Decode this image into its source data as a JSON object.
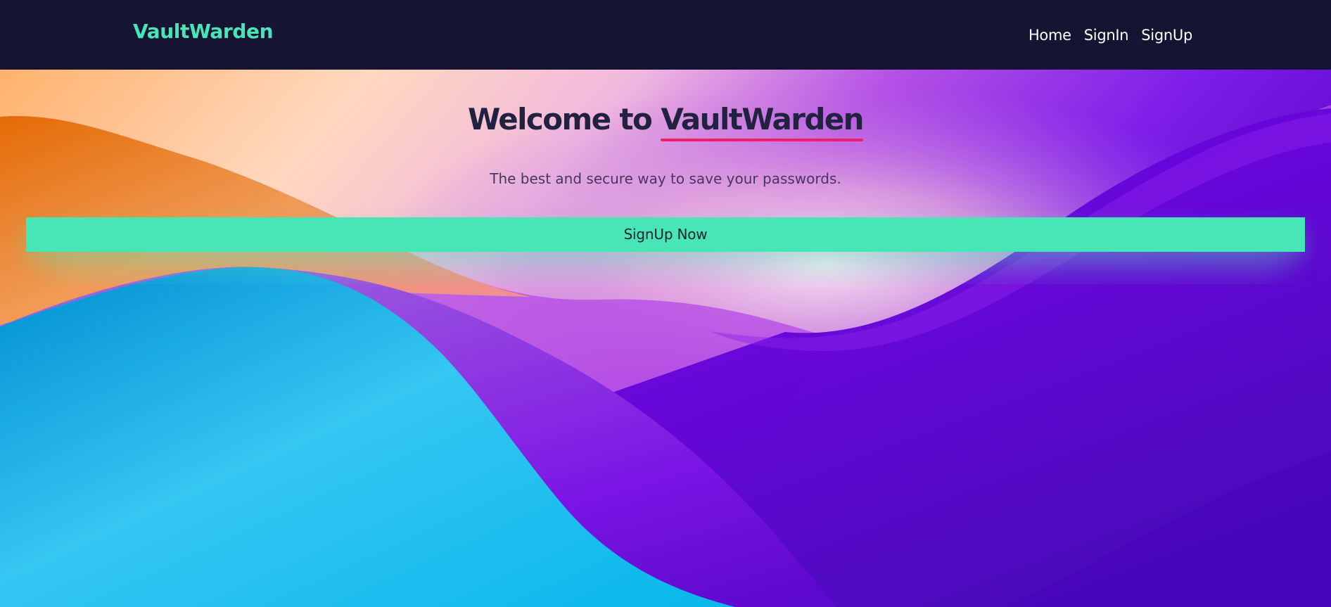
{
  "navbar": {
    "brand": "VaultWarden",
    "links": [
      {
        "label": "Home"
      },
      {
        "label": "SignIn"
      },
      {
        "label": "SignUp"
      }
    ]
  },
  "hero": {
    "headline_prefix": "Welcome to ",
    "headline_brand": "VaultWarden",
    "tagline": "The best and secure way to save your passwords.",
    "cta_label": "SignUp Now"
  },
  "colors": {
    "navbar_background": "#161433",
    "brand_accent": "#48e5b6",
    "headline_text": "#222140",
    "headline_underline": "#f21d68",
    "tagline_text": "#48365f",
    "cta_background": "#48e5b6",
    "cta_text": "#1e2233",
    "nav_text": "#ffffff"
  }
}
